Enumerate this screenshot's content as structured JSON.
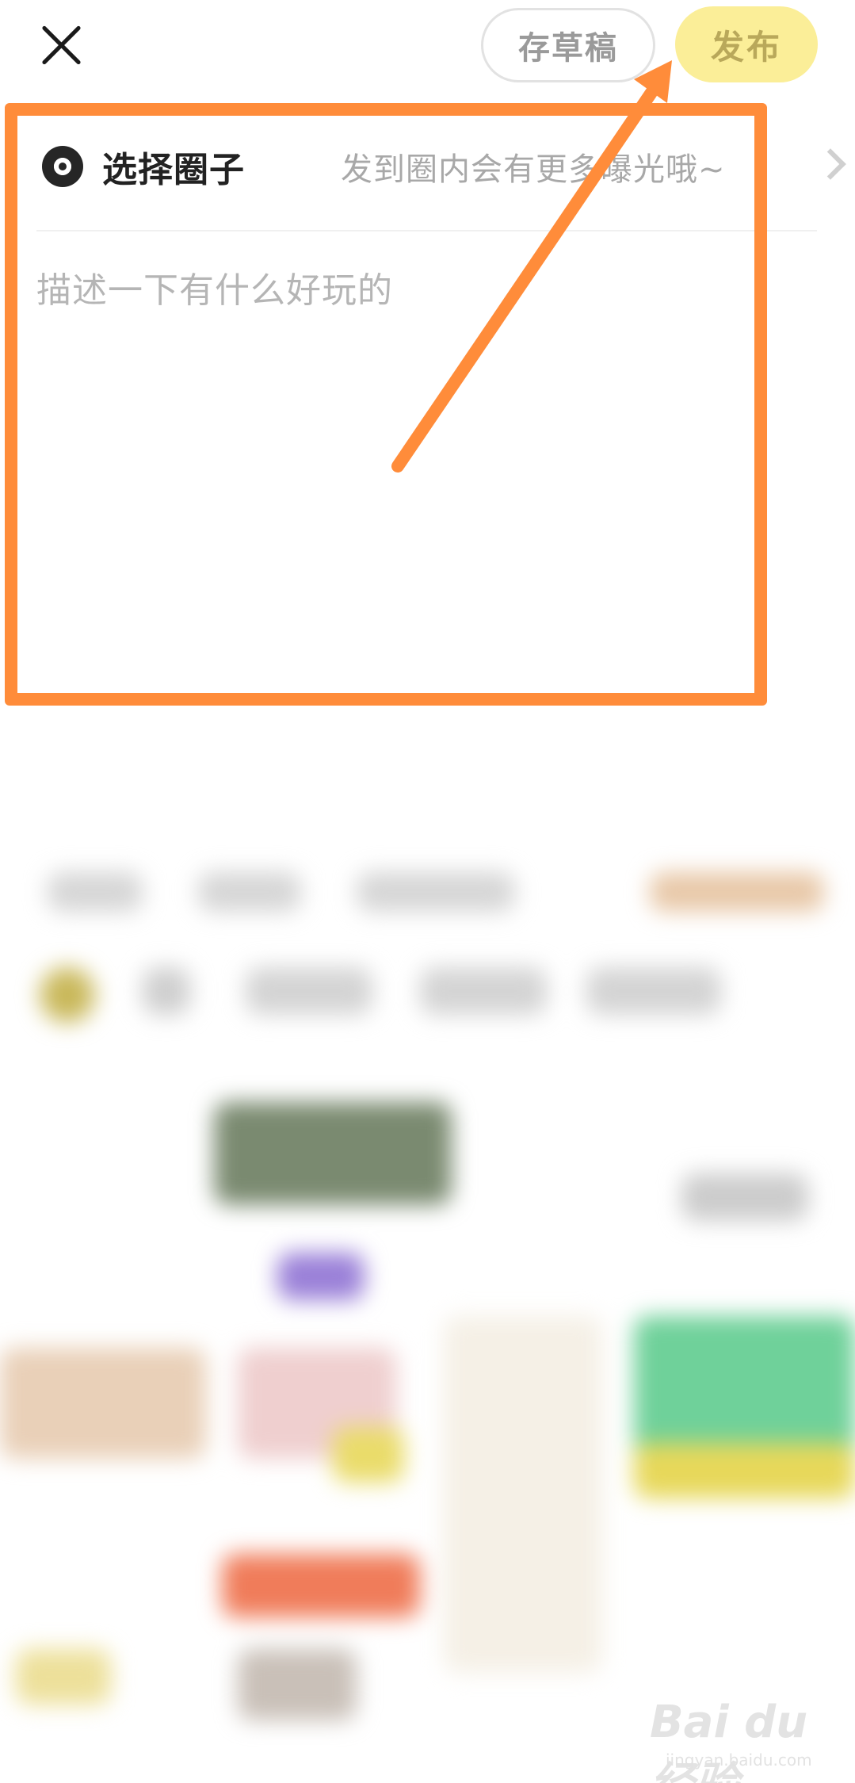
{
  "header": {
    "draft_label": "存草稿",
    "publish_label": "发布"
  },
  "circle_selector": {
    "label": "选择圈子",
    "hint": "发到圈内会有更多曝光哦~"
  },
  "description": {
    "placeholder": "描述一下有什么好玩的"
  },
  "icons": {
    "close": "close-icon",
    "circle": "circle-target-icon",
    "chevron": "chevron-right-icon"
  },
  "colors": {
    "annotation": "#ff8c3a",
    "publish_bg": "#fbee98"
  },
  "watermark": {
    "brand": "Bai du 经验",
    "domain": "jingyan.baidu.com"
  }
}
